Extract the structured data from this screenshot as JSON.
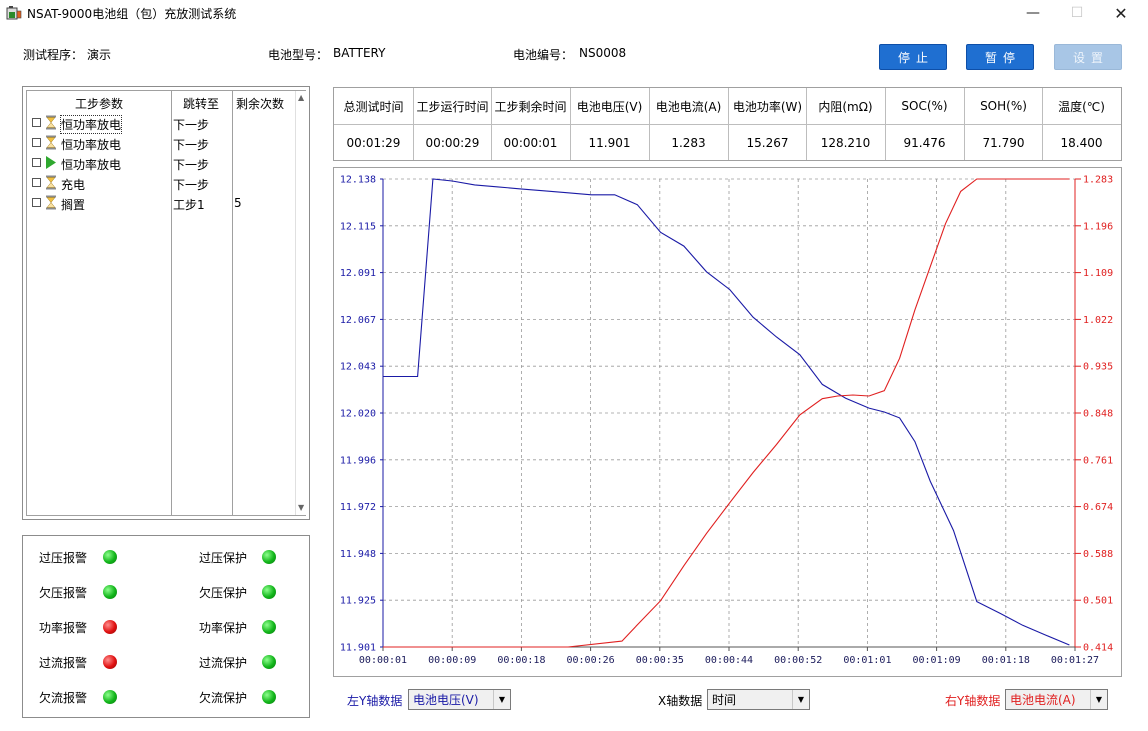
{
  "window": {
    "title": "NSAT-9000电池组（包）充放测试系统",
    "min_glyph": "—",
    "max_glyph": "☐",
    "close_glyph": "✕"
  },
  "info": {
    "program_label": "测试程序：",
    "program_value": "演示",
    "battery_type_label": "电池型号：",
    "battery_type_value": "BATTERY",
    "battery_no_label": "电池编号：",
    "battery_no_value": "NS0008"
  },
  "buttons": {
    "stop": "停止",
    "pause": "暂停",
    "settings": "设置"
  },
  "steps": {
    "headers": [
      "工步参数",
      "跳转至",
      "剩余次数"
    ],
    "rows": [
      {
        "name": "恒功率放电",
        "jump": "下一步",
        "remain": "",
        "icon": "hourglass-icon"
      },
      {
        "name": "恒功率放电",
        "jump": "下一步",
        "remain": "",
        "icon": "hourglass-icon"
      },
      {
        "name": "恒功率放电",
        "jump": "下一步",
        "remain": "",
        "icon": "play-icon"
      },
      {
        "name": "充电",
        "jump": "下一步",
        "remain": "",
        "icon": "hourglass-icon"
      },
      {
        "name": "搁置",
        "jump": "工步1",
        "remain": "5",
        "icon": "hourglass-icon"
      }
    ]
  },
  "alarms": {
    "rows": [
      {
        "left_label": "过压报警",
        "left_status": "green",
        "right_label": "过压保护",
        "right_status": "green"
      },
      {
        "left_label": "欠压报警",
        "left_status": "green",
        "right_label": "欠压保护",
        "right_status": "green"
      },
      {
        "left_label": "功率报警",
        "left_status": "red",
        "right_label": "功率保护",
        "right_status": "green"
      },
      {
        "left_label": "过流报警",
        "left_status": "red",
        "right_label": "过流保护",
        "right_status": "green"
      },
      {
        "left_label": "欠流报警",
        "left_status": "green",
        "right_label": "欠流保护",
        "right_status": "green"
      }
    ]
  },
  "measurements": {
    "headers": [
      "总测试时间",
      "工步运行时间",
      "工步剩余时间",
      "电池电压(V)",
      "电池电流(A)",
      "电池功率(W)",
      "内阻(mΩ)",
      "SOC(%)",
      "SOH(%)",
      "温度(℃)"
    ],
    "values": [
      "00:01:29",
      "00:00:29",
      "00:00:01",
      "11.901",
      "1.283",
      "15.267",
      "128.210",
      "91.476",
      "71.790",
      "18.400"
    ]
  },
  "colors": {
    "left_axis": "#1a1aa6",
    "right_axis": "#e02020",
    "button_blue": "#1f6fd1",
    "led_green": "#12b51a",
    "led_red": "#e01010"
  },
  "chart_data": {
    "type": "line",
    "left_y_ticks": [
      "12.138",
      "12.115",
      "12.091",
      "12.067",
      "12.043",
      "12.020",
      "11.996",
      "11.972",
      "11.948",
      "11.925",
      "11.901"
    ],
    "right_y_ticks": [
      "1.283",
      "1.196",
      "1.109",
      "1.022",
      "0.935",
      "0.848",
      "0.761",
      "0.674",
      "0.588",
      "0.501",
      "0.414"
    ],
    "x_ticks": [
      "00:00:01",
      "00:00:09",
      "00:00:18",
      "00:00:26",
      "00:00:35",
      "00:00:44",
      "00:00:52",
      "00:01:01",
      "00:01:09",
      "00:01:18",
      "00:01:27"
    ],
    "x_range_s": [
      1,
      87
    ],
    "left_ylim": [
      11.901,
      12.138
    ],
    "right_ylim": [
      0.414,
      1.283
    ],
    "grid": true,
    "series": [
      {
        "axis": "left",
        "color": "#1a1aa6",
        "x": [
          1,
          5.3,
          7.2,
          9.6,
          12.4,
          15.3,
          18.1,
          21,
          24,
          26.9,
          29.8,
          32.6,
          35.5,
          38.4,
          41.2,
          44.1,
          47,
          49.9,
          52.8,
          55.6,
          58.5,
          61.4,
          63.3,
          65.2,
          67.1,
          69,
          71.9,
          74.8,
          77.7,
          80.5,
          83.4,
          86.3
        ],
        "y": [
          12.038,
          12.038,
          12.138,
          12.137,
          12.135,
          12.134,
          12.133,
          12.132,
          12.131,
          12.13,
          12.13,
          12.125,
          12.111,
          12.104,
          12.091,
          12.082,
          12.068,
          12.058,
          12.049,
          12.034,
          12.027,
          12.022,
          12.02,
          12.017,
          12.005,
          11.985,
          11.96,
          11.924,
          11.918,
          11.912,
          11.907,
          11.902
        ]
      },
      {
        "axis": "right",
        "color": "#e02020",
        "x": [
          1,
          24,
          30.7,
          32.6,
          35.5,
          38.4,
          41.2,
          44.1,
          47,
          49.9,
          52.8,
          55.6,
          57.5,
          59.4,
          61.4,
          63.3,
          65.2,
          67.1,
          69,
          70.9,
          72.8,
          74.8,
          76.7,
          86.3
        ],
        "y": [
          0.414,
          0.414,
          0.425,
          0.455,
          0.5,
          0.565,
          0.625,
          0.682,
          0.738,
          0.79,
          0.845,
          0.875,
          0.88,
          0.882,
          0.88,
          0.89,
          0.95,
          1.04,
          1.12,
          1.2,
          1.26,
          1.283,
          1.283,
          1.283
        ]
      }
    ]
  },
  "combos": {
    "left_label": "左Y轴数据",
    "left_value": "电池电压(V)",
    "x_label": "X轴数据",
    "x_value": "时间",
    "right_label": "右Y轴数据",
    "right_value": "电池电流(A)"
  }
}
